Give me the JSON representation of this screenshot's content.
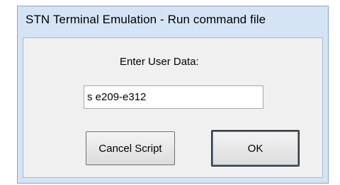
{
  "window": {
    "title": "STN Terminal Emulation - Run command file"
  },
  "dialog": {
    "prompt": "Enter User Data:",
    "input_value": "s e209-e312",
    "cancel_label": "Cancel Script",
    "ok_label": "OK"
  },
  "colors": {
    "frame": "#d5e4f5",
    "client": "#f0f0f0",
    "input_bg": "#ffffff"
  }
}
